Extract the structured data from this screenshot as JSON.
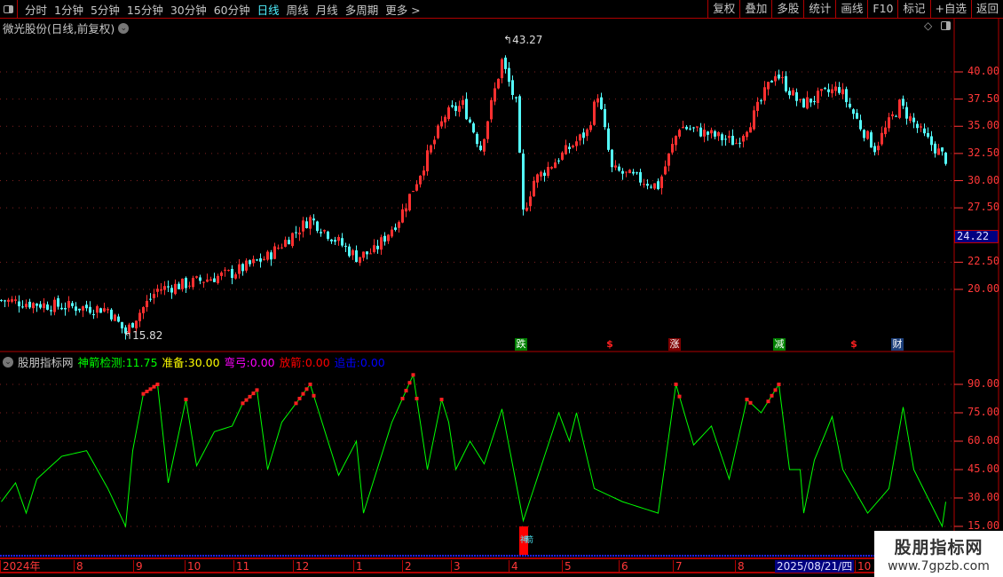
{
  "toolbar": {
    "periods": [
      "分时",
      "1分钟",
      "5分钟",
      "15分钟",
      "30分钟",
      "60分钟",
      "日线",
      "周线",
      "月线",
      "多周期",
      "更多 >"
    ],
    "active_period": "日线",
    "actions": [
      "复权",
      "叠加",
      "多股",
      "统计",
      "画线",
      "F10",
      "标记",
      "+自选",
      "返回"
    ]
  },
  "chart_title": "微光股份(日线,前复权)",
  "price_axis": {
    "ticks": [
      "40.00",
      "37.50",
      "35.00",
      "32.50",
      "30.00",
      "27.50",
      "22.50",
      "20.00"
    ],
    "current_price": "24.22"
  },
  "annotations": {
    "high": "43.27",
    "low": "15.82"
  },
  "event_markers": [
    {
      "label": "跌",
      "color": "#008000"
    },
    {
      "label": "$",
      "color": "#000000"
    },
    {
      "label": "涨",
      "color": "#800000"
    },
    {
      "label": "减",
      "color": "#008000"
    },
    {
      "label": "$",
      "color": "#000000"
    },
    {
      "label": "财",
      "color": "#1c3f7a"
    }
  ],
  "indicator": {
    "name": "股朋指标网",
    "items": [
      {
        "label": "神箭检测:",
        "value": "11.75",
        "color": "#00ff00"
      },
      {
        "label": "准备:",
        "value": "30.00",
        "color": "#ffff00"
      },
      {
        "label": "弯弓:",
        "value": "0.00",
        "color": "#ff00ff"
      },
      {
        "label": "放箭:",
        "value": "0.00",
        "color": "#ff0000"
      },
      {
        "label": "追击:",
        "value": "0.00",
        "color": "#0000ff"
      }
    ],
    "ticks": [
      "90.00",
      "75.00",
      "60.00",
      "45.00",
      "30.00",
      "15.00"
    ],
    "signal_label": "神箭"
  },
  "date_axis": {
    "labels": [
      "2024年",
      "8",
      "9",
      "10",
      "11",
      "12",
      "1",
      "2",
      "3",
      "4",
      "5",
      "6",
      "7",
      "8",
      "10"
    ],
    "cursor_date": "2025/08/21/四"
  },
  "watermark": {
    "title": "股朋指标网",
    "url": "www.7gpzb.com"
  },
  "colors": {
    "up": "#ff3030",
    "down": "#54fcfc",
    "axis": "#ff3838",
    "line": "#00ff00"
  },
  "chart_data": {
    "type": "line",
    "price_anchors": [
      [
        0,
        19
      ],
      [
        15,
        18.5
      ],
      [
        30,
        18.2
      ],
      [
        35,
        16
      ],
      [
        38,
        17.5
      ],
      [
        44,
        20
      ],
      [
        52,
        20.5
      ],
      [
        65,
        21.5
      ],
      [
        75,
        23
      ],
      [
        87,
        26.5
      ],
      [
        100,
        23
      ],
      [
        105,
        23.5
      ],
      [
        112,
        26.5
      ],
      [
        117,
        30
      ],
      [
        125,
        36
      ],
      [
        130,
        37
      ],
      [
        135,
        33
      ],
      [
        141,
        41
      ],
      [
        145,
        37
      ],
      [
        147,
        27
      ],
      [
        150,
        30
      ],
      [
        160,
        33
      ],
      [
        165,
        34.5
      ],
      [
        168,
        38
      ],
      [
        172,
        31
      ],
      [
        185,
        29.5
      ],
      [
        191,
        35
      ],
      [
        197,
        34.5
      ],
      [
        207,
        33.5
      ],
      [
        212,
        36
      ],
      [
        218,
        40
      ],
      [
        225,
        37
      ],
      [
        232,
        38
      ],
      [
        236,
        38.5
      ],
      [
        242,
        35
      ],
      [
        246,
        33
      ],
      [
        253,
        37
      ],
      [
        260,
        34
      ],
      [
        266,
        32
      ]
    ],
    "indicator_anchors": [
      [
        0,
        28
      ],
      [
        4,
        38
      ],
      [
        7,
        22
      ],
      [
        10,
        40
      ],
      [
        17,
        52
      ],
      [
        24,
        55
      ],
      [
        30,
        35
      ],
      [
        35,
        15
      ],
      [
        37,
        55
      ],
      [
        40,
        85
      ],
      [
        44,
        90
      ],
      [
        47,
        38
      ],
      [
        52,
        82
      ],
      [
        55,
        47
      ],
      [
        60,
        65
      ],
      [
        65,
        68
      ],
      [
        68,
        80
      ],
      [
        72,
        87
      ],
      [
        75,
        45
      ],
      [
        79,
        70
      ],
      [
        83,
        80
      ],
      [
        87,
        90
      ],
      [
        95,
        42
      ],
      [
        100,
        60
      ],
      [
        102,
        22
      ],
      [
        110,
        70
      ],
      [
        116,
        95
      ],
      [
        120,
        45
      ],
      [
        124,
        82
      ],
      [
        126,
        70
      ],
      [
        128,
        45
      ],
      [
        132,
        60
      ],
      [
        136,
        48
      ],
      [
        141,
        77
      ],
      [
        147,
        18
      ],
      [
        157,
        75
      ],
      [
        160,
        60
      ],
      [
        162,
        75
      ],
      [
        167,
        35
      ],
      [
        175,
        28
      ],
      [
        185,
        22
      ],
      [
        190,
        90
      ],
      [
        195,
        58
      ],
      [
        200,
        68
      ],
      [
        205,
        40
      ],
      [
        210,
        82
      ],
      [
        214,
        75
      ],
      [
        219,
        90
      ],
      [
        222,
        45
      ],
      [
        225,
        45
      ],
      [
        226,
        22
      ],
      [
        229,
        50
      ],
      [
        234,
        73
      ],
      [
        237,
        45
      ],
      [
        244,
        22
      ],
      [
        250,
        35
      ],
      [
        254,
        78
      ],
      [
        257,
        45
      ],
      [
        261,
        30
      ],
      [
        265,
        15
      ],
      [
        266,
        28
      ]
    ],
    "bars": 267,
    "price_range": [
      15,
      44
    ],
    "indicator_range": [
      10,
      100
    ]
  }
}
